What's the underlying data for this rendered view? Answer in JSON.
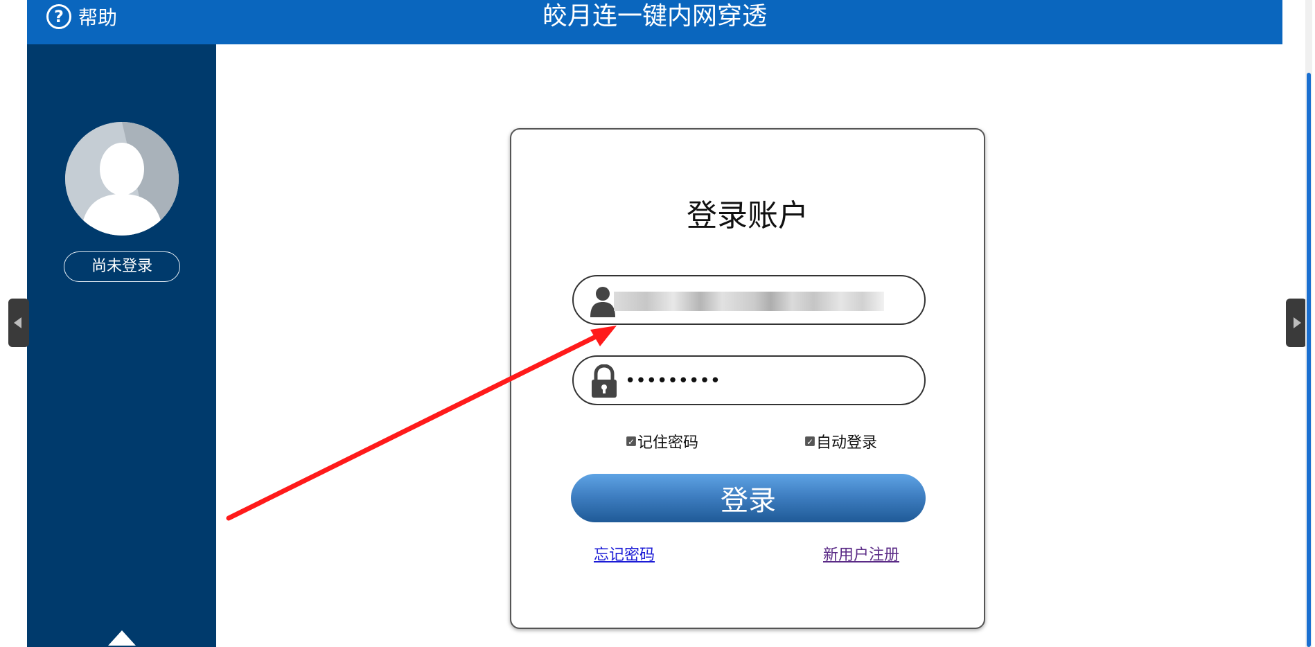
{
  "header": {
    "help_label": "帮助",
    "help_icon": "question-circle-icon",
    "title": "皎月连一键内网穿透"
  },
  "sidebar": {
    "avatar_icon": "user-avatar-icon",
    "status_button": "尚未登录",
    "collapse_icon": "chevron-up-icon"
  },
  "login": {
    "title": "登录账户",
    "username": {
      "icon": "user-icon",
      "value": ""
    },
    "password": {
      "icon": "lock-icon",
      "value": "•••••••••"
    },
    "remember_password": {
      "label": "记住密码",
      "checked": true
    },
    "auto_login": {
      "label": "自动登录",
      "checked": true
    },
    "submit_label": "登录",
    "forgot_link": "忘记密码",
    "register_link": "新用户注册"
  },
  "colors": {
    "header_bg": "#0a66be",
    "sidebar_bg": "#003a6c",
    "button_gradient_top": "#5ea3e4",
    "button_gradient_bottom": "#1f5a97",
    "annotation_arrow": "#ff1a1a"
  }
}
